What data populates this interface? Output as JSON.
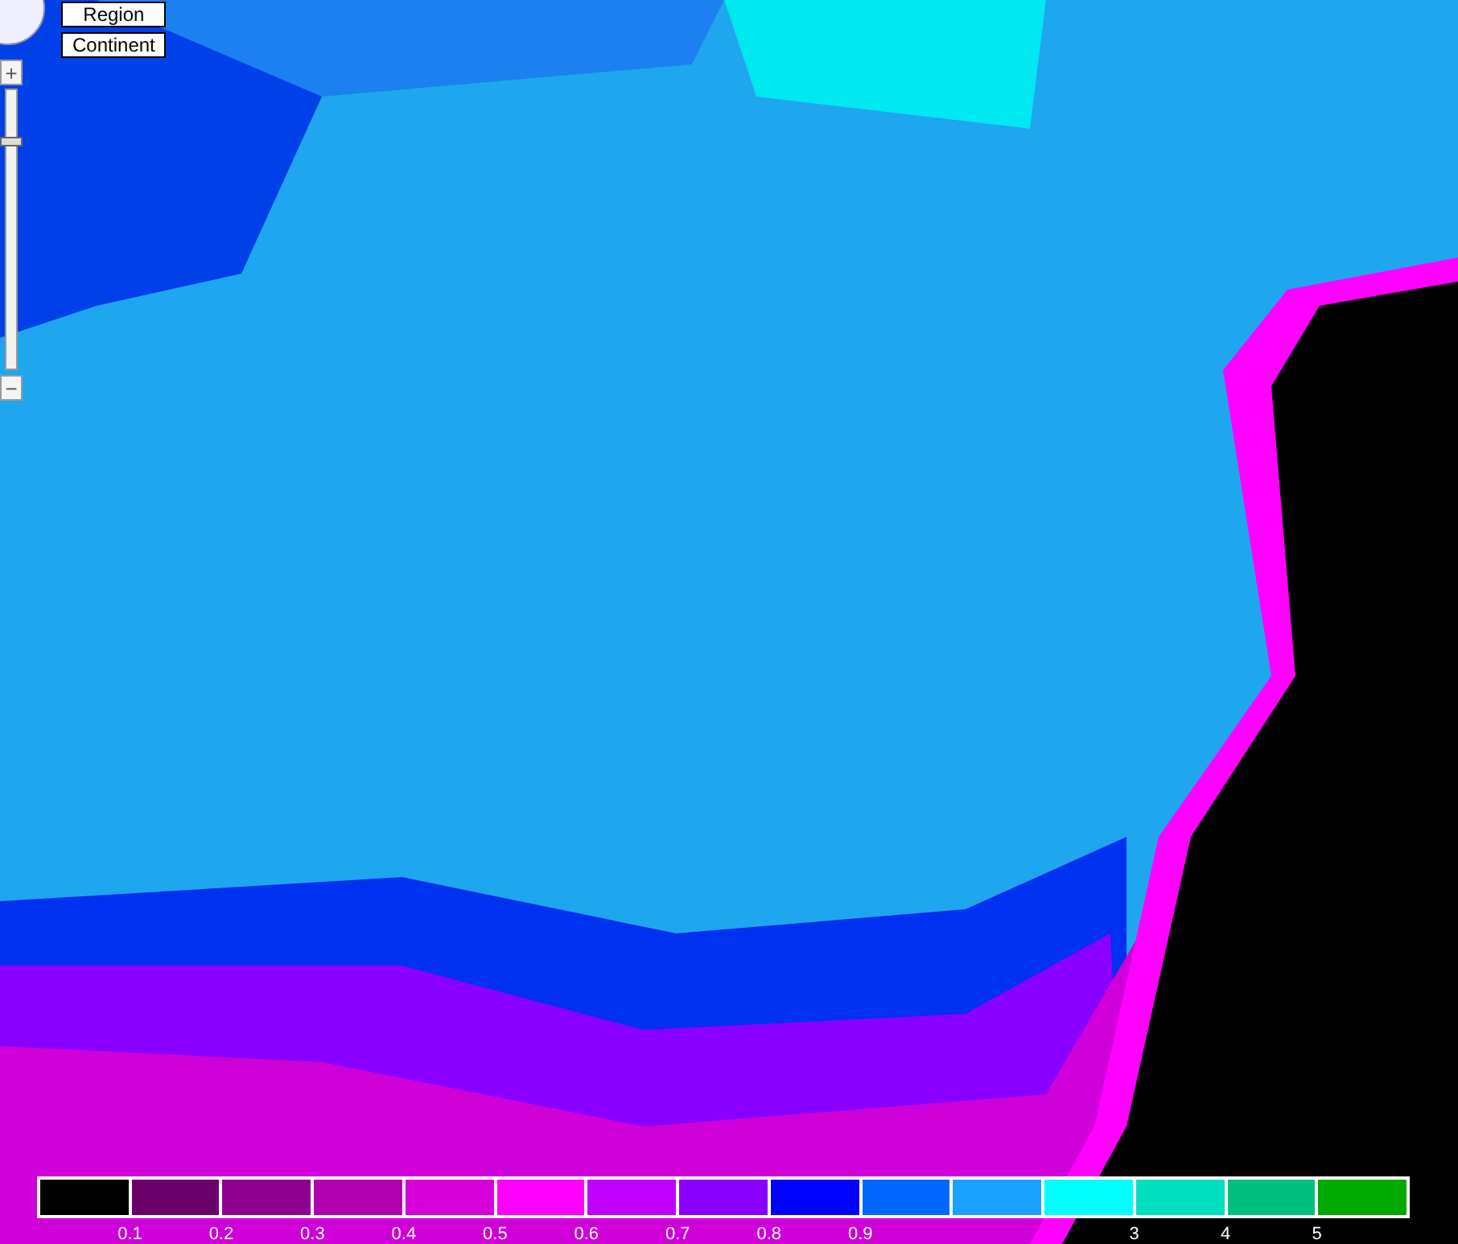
{
  "map_buttons": [
    {
      "label": "Region"
    },
    {
      "label": "Continent"
    }
  ],
  "zoom": {
    "plus": "+",
    "minus": "−",
    "level": 0.83
  },
  "legend": {
    "swatches": [
      {
        "color": "#000000",
        "tick": "0.1"
      },
      {
        "color": "#6a006a",
        "tick": "0.2"
      },
      {
        "color": "#8e008e",
        "tick": "0.3"
      },
      {
        "color": "#b000b0",
        "tick": "0.4"
      },
      {
        "color": "#d800d8",
        "tick": "0.5"
      },
      {
        "color": "#ff00ff",
        "tick": "0.6"
      },
      {
        "color": "#c000ff",
        "tick": "0.7"
      },
      {
        "color": "#8a00ff",
        "tick": "0.8"
      },
      {
        "color": "#0000ff",
        "tick": "0.9"
      },
      {
        "color": "#0066ff"
      },
      {
        "color": "#1aa0ff"
      },
      {
        "color": "#00ffff",
        "tick": "3"
      },
      {
        "color": "#00e0c0",
        "tick": "4"
      },
      {
        "color": "#00c080",
        "tick": "5"
      },
      {
        "color": "#00aa00"
      }
    ]
  }
}
